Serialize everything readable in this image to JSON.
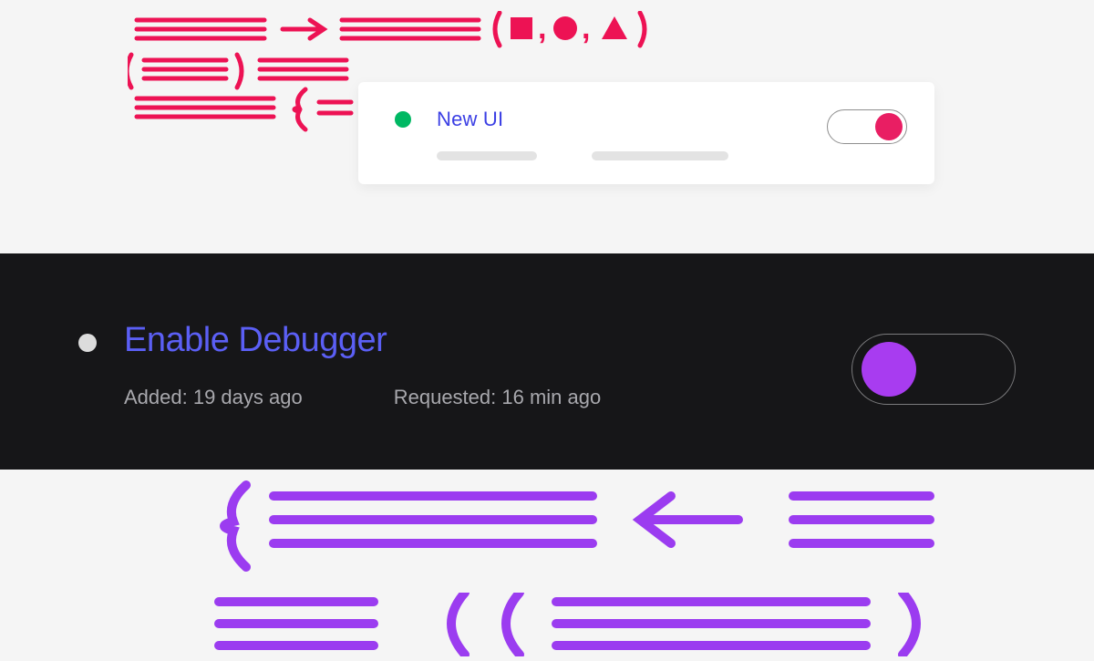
{
  "small_card": {
    "title": "New UI",
    "status_color": "#00b863",
    "toggle_state": "on",
    "toggle_color": "#e91e63"
  },
  "dark_card": {
    "title": "Enable Debugger",
    "added_label": "Added: 19 days ago",
    "requested_label": "Requested: 16 min ago",
    "status_color": "#dcdcdc",
    "toggle_state": "off",
    "toggle_color": "#a83cf0"
  },
  "colors": {
    "pink": "#ed1254",
    "purple": "#9b3cf0",
    "blue_text": "#3b3fe4",
    "blue_text_bright": "#5b5ff5"
  }
}
